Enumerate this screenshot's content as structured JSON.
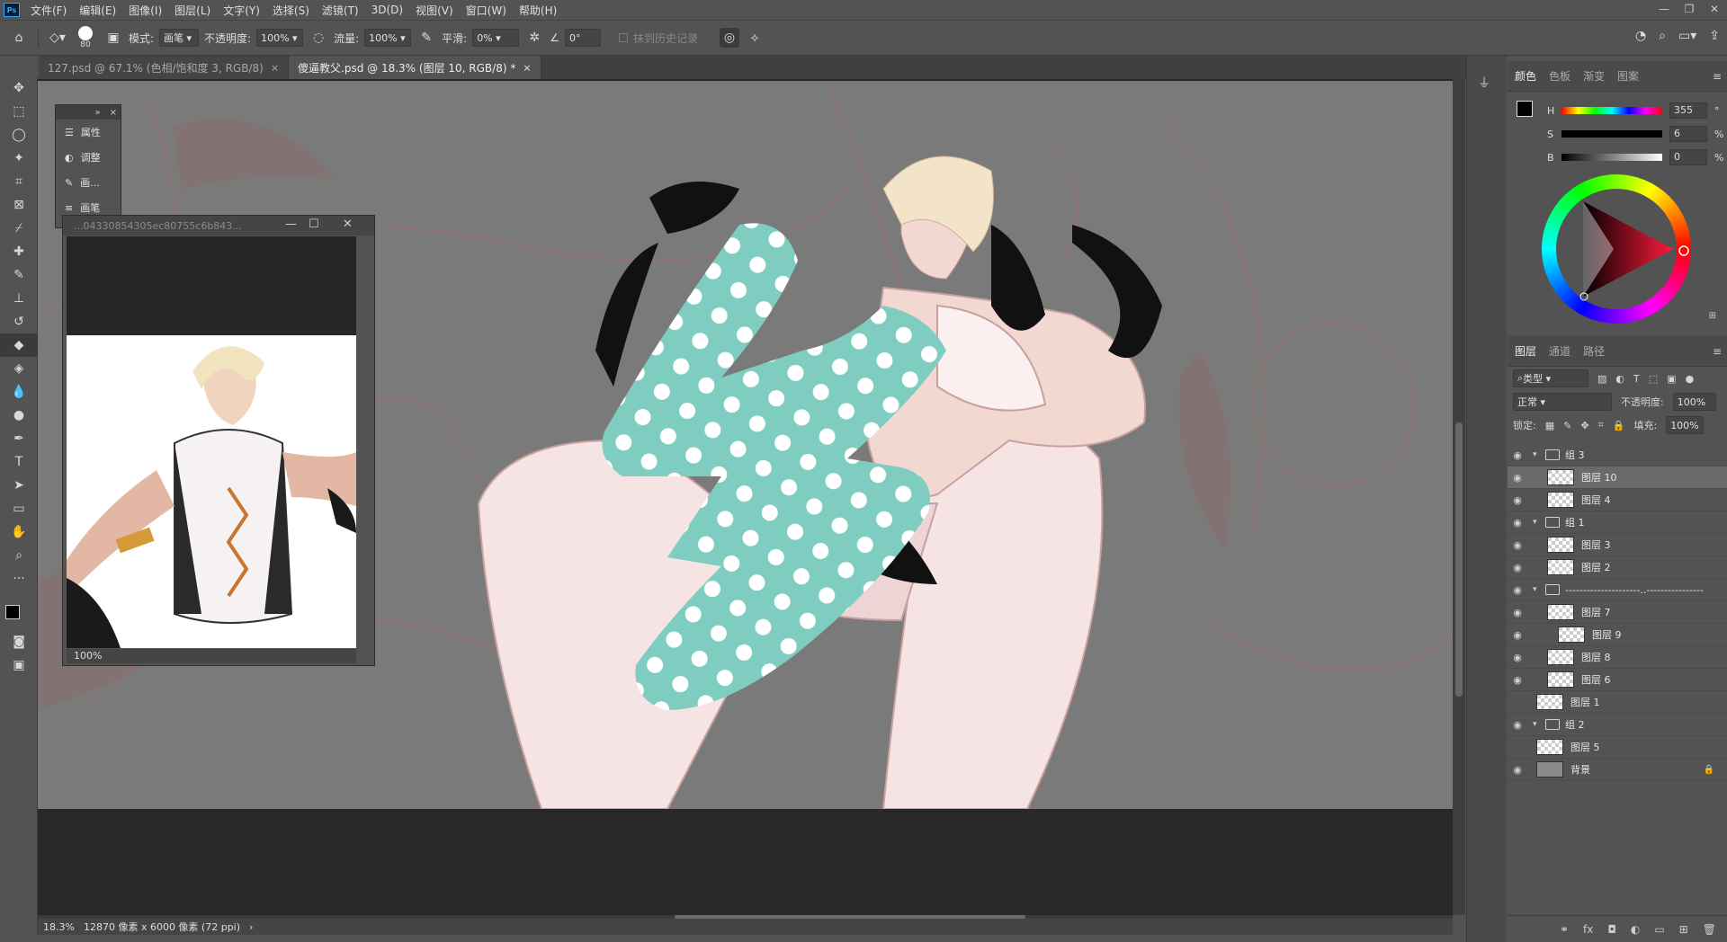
{
  "menu": {
    "logo": "Ps",
    "items": [
      "文件(F)",
      "编辑(E)",
      "图像(I)",
      "图层(L)",
      "文字(Y)",
      "选择(S)",
      "滤镜(T)",
      "3D(D)",
      "视图(V)",
      "窗口(W)",
      "帮助(H)"
    ],
    "window_controls": [
      "—",
      "❐",
      "✕"
    ]
  },
  "options": {
    "brush_size": "80",
    "mode_label": "模式:",
    "mode_value": "画笔",
    "opacity_label": "不透明度:",
    "opacity_value": "100%",
    "flow_label": "流量:",
    "flow_value": "100%",
    "smooth_label": "平滑:",
    "smooth_value": "0%",
    "angle_value": "0°",
    "erase_history_label": "抹到历史记录"
  },
  "tabs": [
    {
      "label": "127.psd @ 67.1% (色相/饱和度 3, RGB/8)",
      "active": false
    },
    {
      "label": "傻逼教父.psd @ 18.3% (图层 10, RGB/8) *",
      "active": true
    }
  ],
  "floatpanel": {
    "items": [
      "属性",
      "调整",
      "画...",
      "画笔"
    ]
  },
  "navigator": {
    "title": "...04330854305ec80755c6b843...",
    "zoom": "100%"
  },
  "status": {
    "zoom": "18.3%",
    "doc_info": "12870 像素 x 6000 像素 (72 ppi)"
  },
  "color_panel": {
    "tabs": [
      "颜色",
      "色板",
      "渐变",
      "图案"
    ],
    "h": "355",
    "h_unit": "°",
    "s": "6",
    "s_unit": "%",
    "b": "0",
    "b_unit": "%",
    "fg_color": "#000000",
    "bg_color": "#ffffff"
  },
  "layers_panel": {
    "tabs": [
      "图层",
      "通道",
      "路径"
    ],
    "filter_label": "类型",
    "blend_mode": "正常",
    "opacity_label": "不透明度:",
    "opacity_value": "100%",
    "lock_label": "锁定:",
    "fill_label": "填充:",
    "fill_value": "100%",
    "layers": [
      {
        "name": "组 3",
        "type": "group",
        "visible": true,
        "indent": 0
      },
      {
        "name": "图层 10",
        "type": "layer",
        "visible": true,
        "indent": 1,
        "selected": true
      },
      {
        "name": "图层 4",
        "type": "layer",
        "visible": true,
        "indent": 1
      },
      {
        "name": "组 1",
        "type": "group",
        "visible": true,
        "indent": 0
      },
      {
        "name": "图层 3",
        "type": "layer",
        "visible": true,
        "indent": 1
      },
      {
        "name": "图层 2",
        "type": "layer",
        "visible": true,
        "indent": 1
      },
      {
        "name": "---------------------..----------------",
        "type": "group",
        "visible": true,
        "indent": 0
      },
      {
        "name": "图层 7",
        "type": "layer",
        "visible": true,
        "indent": 1
      },
      {
        "name": "图层 9",
        "type": "layer",
        "visible": true,
        "indent": 2
      },
      {
        "name": "图层 8",
        "type": "layer",
        "visible": true,
        "indent": 1
      },
      {
        "name": "图层 6",
        "type": "layer",
        "visible": true,
        "indent": 1
      },
      {
        "name": "图层 1",
        "type": "layer",
        "visible": false,
        "indent": 0
      },
      {
        "name": "组 2",
        "type": "group",
        "visible": true,
        "indent": 0
      },
      {
        "name": "图层 5",
        "type": "layer",
        "visible": false,
        "indent": 0
      },
      {
        "name": "背景",
        "type": "background",
        "visible": true,
        "indent": 0
      }
    ],
    "bottom_icons": [
      "link-icon",
      "fx-icon",
      "mask-icon",
      "adjustment-icon",
      "new-group-icon",
      "new-layer-icon",
      "trash-icon"
    ]
  },
  "colors": {
    "accent_teal": "#7ecdc0",
    "canvas_gray": "#7a7a7a",
    "skin": "#f1d4d0"
  }
}
